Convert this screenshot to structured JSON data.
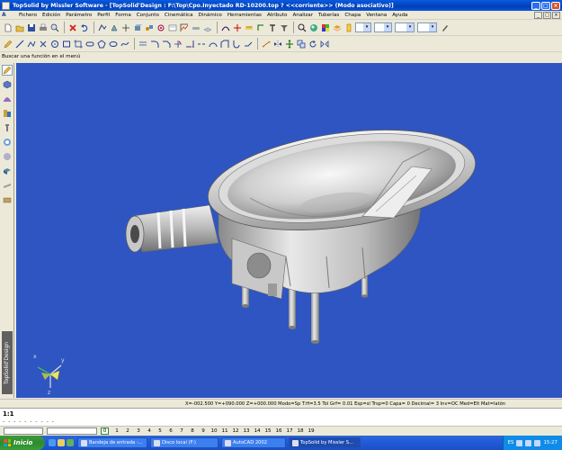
{
  "window": {
    "title": "TopSolid by Missler Software - [TopSolid'Design : F:\\Top\\Cpo.Inyectado RD-10200.top ?  <<corriente>> (Modo asociativo)]",
    "minimize": "_",
    "maximize": "□",
    "close": "×"
  },
  "menu": {
    "logo": "A",
    "items": [
      "Fichero",
      "Edición",
      "Parámetro",
      "Perfil",
      "Forma",
      "Conjunto",
      "Cinemática",
      "Dinámico",
      "Herramientas",
      "Atributo",
      "Analizar",
      "Tuberías",
      "Chapa",
      "Ventana",
      "Ayuda"
    ]
  },
  "search": {
    "label": "Buscar una función en el menú"
  },
  "left_toolbar": {
    "brand": "TopSolid'Design"
  },
  "viewport": {
    "background": "#2f55c2",
    "axes": {
      "x": "x",
      "y": "y",
      "z": "z"
    }
  },
  "status": {
    "text": "X=-002.500   Y=+090.000   Z=+000.000  Modo=Sp   T:H=3.5      Tol Grf= 0.01   Esp=sl   Trsp=0    Capa= 0   Decimal= 3   Inv=OC  Med=Elt   Mat=latón"
  },
  "command": {
    "ratio": "1:1",
    "dashes": "- - - - - - - - - -"
  },
  "layers": {
    "active": "0",
    "numbers": [
      "1",
      "2",
      "3",
      "4",
      "5",
      "6",
      "7",
      "8",
      "9",
      "10",
      "11",
      "12",
      "13",
      "14",
      "15",
      "16",
      "17",
      "18",
      "19"
    ]
  },
  "taskbar": {
    "start": "Inicio",
    "tasks": [
      "Bandeja de entrada -...",
      "Disco local (F:)",
      "AutoCAD 2002",
      "TopSolid by Missler S..."
    ],
    "lang": "ES",
    "clock": "15:27"
  }
}
